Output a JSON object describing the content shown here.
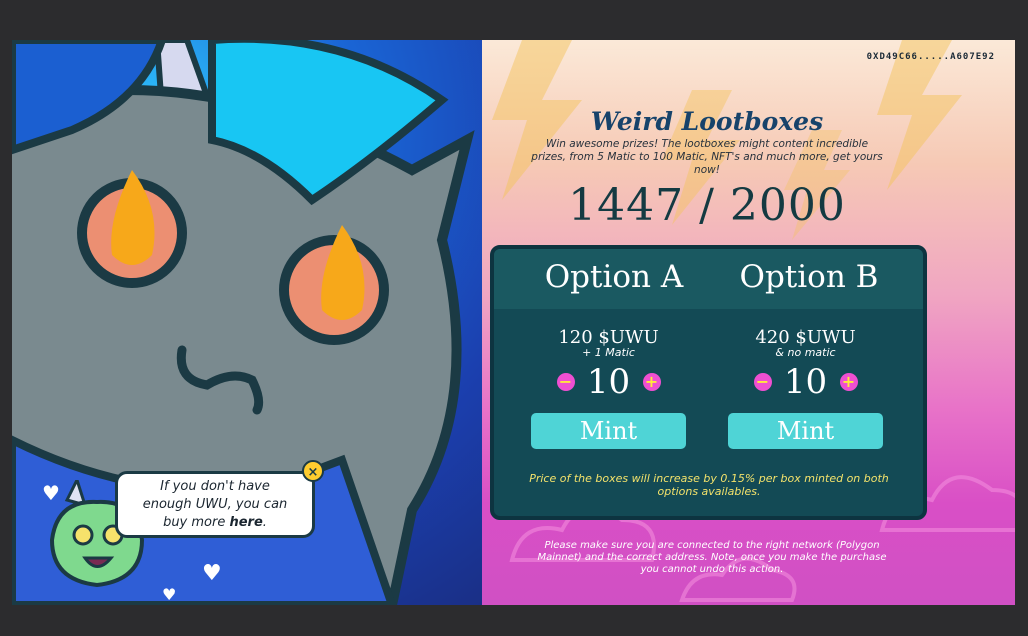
{
  "header": {
    "wallet_address": "0XD49C66.....A607E92"
  },
  "hero": {
    "title": "Weird Lootboxes",
    "description": "Win awesome prizes! The lootboxes might content incredible prizes, from 5 Matic to 100 Matic, NFT's and much more, get yours now!",
    "minted": "1447 / 2000"
  },
  "options": [
    {
      "title": "Option A",
      "price": "120 $UWU",
      "extra": "+ 1 Matic",
      "quantity": "10",
      "minus": "−",
      "plus": "+",
      "mint_label": "Mint"
    },
    {
      "title": "Option B",
      "price": "420 $UWU",
      "extra": "& no matic",
      "quantity": "10",
      "minus": "−",
      "plus": "+",
      "mint_label": "Mint"
    }
  ],
  "card_note": "Price of the boxes will increase by 0.15% per box minted on both options availables.",
  "footer_note": "Please make sure you are connected to the right network (Polygon Mainnet) and the correct address. Note, once you make the purchase you cannot undo this action.",
  "helper": {
    "line1": "If you don't have",
    "line2": "enough UWU, you can",
    "line3": "buy more",
    "link": "here",
    "suffix": ".",
    "close": "×"
  },
  "colors": {
    "card_bg": "#134a55",
    "mint_button": "#4fd4d6",
    "stepper": "#ef4fd1",
    "note": "#f3e26b",
    "title": "#17436b"
  }
}
